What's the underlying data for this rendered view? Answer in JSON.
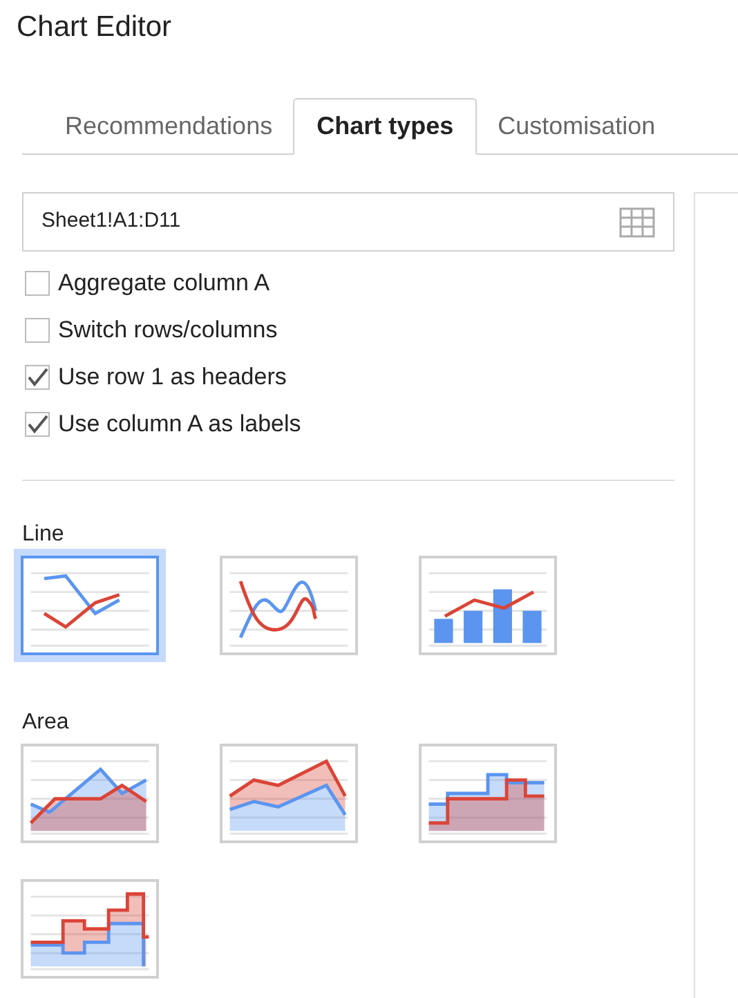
{
  "window": {
    "title": "Chart Editor"
  },
  "tabs": [
    {
      "label": "Recommendations",
      "selected": false
    },
    {
      "label": "Chart types",
      "selected": true
    },
    {
      "label": "Customisation",
      "selected": false
    }
  ],
  "range_field": {
    "value": "Sheet1!A1:D11"
  },
  "options": [
    {
      "label": "Aggregate column A",
      "checked": false
    },
    {
      "label": "Switch rows/columns",
      "checked": false
    },
    {
      "label": "Use row 1 as headers",
      "checked": true
    },
    {
      "label": "Use column A as labels",
      "checked": true
    }
  ],
  "sections": [
    {
      "title": "Line",
      "charts": [
        {
          "kind": "line",
          "selected": true
        },
        {
          "kind": "curve",
          "selected": false
        },
        {
          "kind": "combo",
          "selected": false
        }
      ]
    },
    {
      "title": "Area",
      "charts": [
        {
          "kind": "area",
          "selected": false
        },
        {
          "kind": "stacked-area",
          "selected": false
        },
        {
          "kind": "stepped-area",
          "selected": false
        },
        {
          "kind": "stacked-stepped-area",
          "selected": false
        }
      ]
    }
  ]
}
